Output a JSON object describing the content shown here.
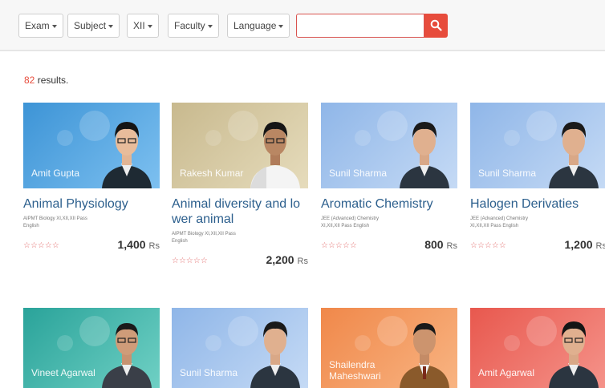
{
  "filters": {
    "exam": "Exam",
    "subject": "Subject",
    "class": "XII",
    "faculty": "Faculty",
    "language": "Language"
  },
  "search": {
    "placeholder": ""
  },
  "results": {
    "count": "82",
    "label": "results."
  },
  "colors": {
    "accent": "#e74c3c",
    "title": "#2c5f8d"
  },
  "courses": [
    {
      "teacher": "Amit Gupta",
      "title": "Animal Physiology",
      "meta1": "AIPMT  Biology  XI,XII,XII Pass",
      "meta2": "English",
      "rating": "☆☆☆☆☆",
      "price": "1,400",
      "currency": "Rs"
    },
    {
      "teacher": "Rakesh Kumar",
      "title": "Animal diversity and lo wer animal",
      "meta1": "AIPMT  Biology  XI,XII,XII Pass",
      "meta2": "English",
      "rating": "☆☆☆☆☆",
      "price": "2,200",
      "currency": "Rs"
    },
    {
      "teacher": "Sunil Sharma",
      "title": "Aromatic Chemistry",
      "meta1": "JEE (Advanced)  Chemistry",
      "meta2": "XI,XII,XII Pass  English",
      "rating": "☆☆☆☆☆",
      "price": "800",
      "currency": "Rs"
    },
    {
      "teacher": "Sunil Sharma",
      "title": "Halogen Derivaties",
      "meta1": "JEE (Advanced)  Chemistry",
      "meta2": "XI,XII,XII Pass  English",
      "rating": "☆☆☆☆☆",
      "price": "1,200",
      "currency": "Rs"
    }
  ],
  "courses_row2": [
    {
      "teacher": "Vineet Agarwal"
    },
    {
      "teacher": "Sunil Sharma"
    },
    {
      "teacher": "Shailendra Maheshwari"
    },
    {
      "teacher": "Amit Agarwal"
    }
  ]
}
